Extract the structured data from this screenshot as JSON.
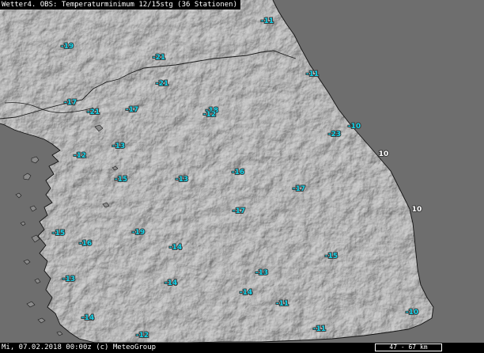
{
  "header": {
    "title": "Wetter4. OBS: Temperaturminimum 12/15stg (36 Stationen)"
  },
  "footer": {
    "timestamp": "Mi, 07.02.2018 00:00z (c) MeteoGroup",
    "scale": "47 - 67 km"
  },
  "colors": {
    "sea": "#6e6e6e",
    "land": "#8a8a8a",
    "temperature_label": "#14d2e8",
    "temperature_label_warm": "#ffffff"
  },
  "stations": [
    {
      "value": "-11",
      "color": "cyan"
    },
    {
      "value": "-19",
      "color": "cyan"
    },
    {
      "value": "-21",
      "color": "cyan"
    },
    {
      "value": "-21",
      "color": "cyan"
    },
    {
      "value": "-11",
      "color": "cyan"
    },
    {
      "value": "-17",
      "color": "cyan"
    },
    {
      "value": "-21",
      "color": "cyan"
    },
    {
      "value": "-17",
      "color": "cyan"
    },
    {
      "value": "-18",
      "color": "cyan"
    },
    {
      "value": "-12",
      "color": "cyan"
    },
    {
      "value": "-10",
      "color": "cyan"
    },
    {
      "value": "-23",
      "color": "cyan"
    },
    {
      "value": "-13",
      "color": "cyan"
    },
    {
      "value": "10",
      "color": "white"
    },
    {
      "value": "-12",
      "color": "cyan"
    },
    {
      "value": "-16",
      "color": "cyan"
    },
    {
      "value": "-15",
      "color": "cyan"
    },
    {
      "value": "-13",
      "color": "cyan"
    },
    {
      "value": "-17",
      "color": "cyan"
    },
    {
      "value": "-17",
      "color": "cyan"
    },
    {
      "value": "10",
      "color": "white"
    },
    {
      "value": "-15",
      "color": "cyan"
    },
    {
      "value": "-19",
      "color": "cyan"
    },
    {
      "value": "-16",
      "color": "cyan"
    },
    {
      "value": "-14",
      "color": "cyan"
    },
    {
      "value": "-15",
      "color": "cyan"
    },
    {
      "value": "-13",
      "color": "cyan"
    },
    {
      "value": "-13",
      "color": "cyan"
    },
    {
      "value": "-14",
      "color": "cyan"
    },
    {
      "value": "-14",
      "color": "cyan"
    },
    {
      "value": "-11",
      "color": "cyan"
    },
    {
      "value": "-14",
      "color": "cyan"
    },
    {
      "value": "-10",
      "color": "cyan"
    },
    {
      "value": "-11",
      "color": "cyan"
    },
    {
      "value": "-12",
      "color": "cyan"
    }
  ]
}
